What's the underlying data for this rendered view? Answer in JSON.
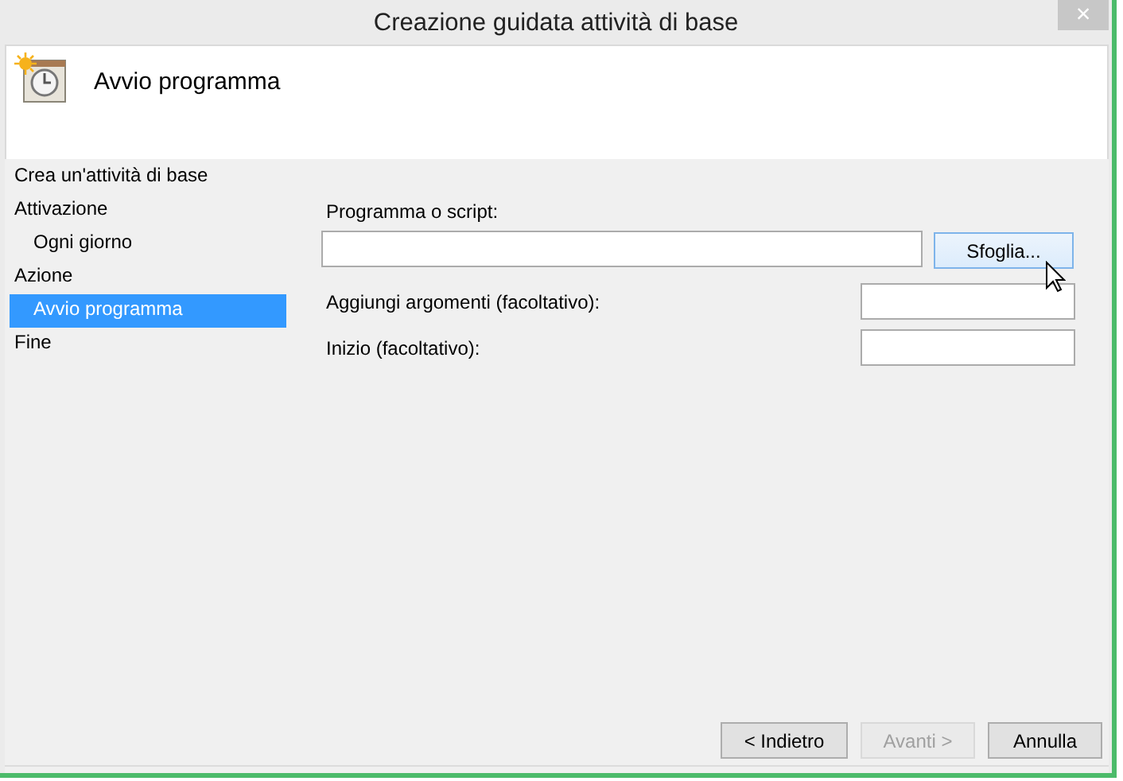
{
  "window": {
    "title": "Creazione guidata attività di base",
    "close": "×"
  },
  "header": {
    "title": "Avvio programma"
  },
  "sidebar": {
    "items": [
      {
        "label": "Crea un'attività di base",
        "selected": false
      },
      {
        "label": "Attivazione",
        "selected": false,
        "children": [
          {
            "label": "Ogni giorno",
            "selected": false
          }
        ]
      },
      {
        "label": "Azione",
        "selected": false,
        "children": [
          {
            "label": "Avvio programma",
            "selected": true
          }
        ]
      },
      {
        "label": "Fine",
        "selected": false
      }
    ]
  },
  "form": {
    "program_label": "Programma o script:",
    "browse_button": {
      "label": "Sfoglia...",
      "highlighted": true
    },
    "fields": [
      {
        "label": "Aggiungi argomenti (facoltativo):"
      },
      {
        "label": "Inizio (facoltativo):"
      }
    ]
  },
  "buttons": [
    {
      "label": "< Indietro",
      "disabled": false
    },
    {
      "label": "Avanti >",
      "disabled": true
    },
    {
      "label": "Annulla",
      "disabled": false
    }
  ]
}
